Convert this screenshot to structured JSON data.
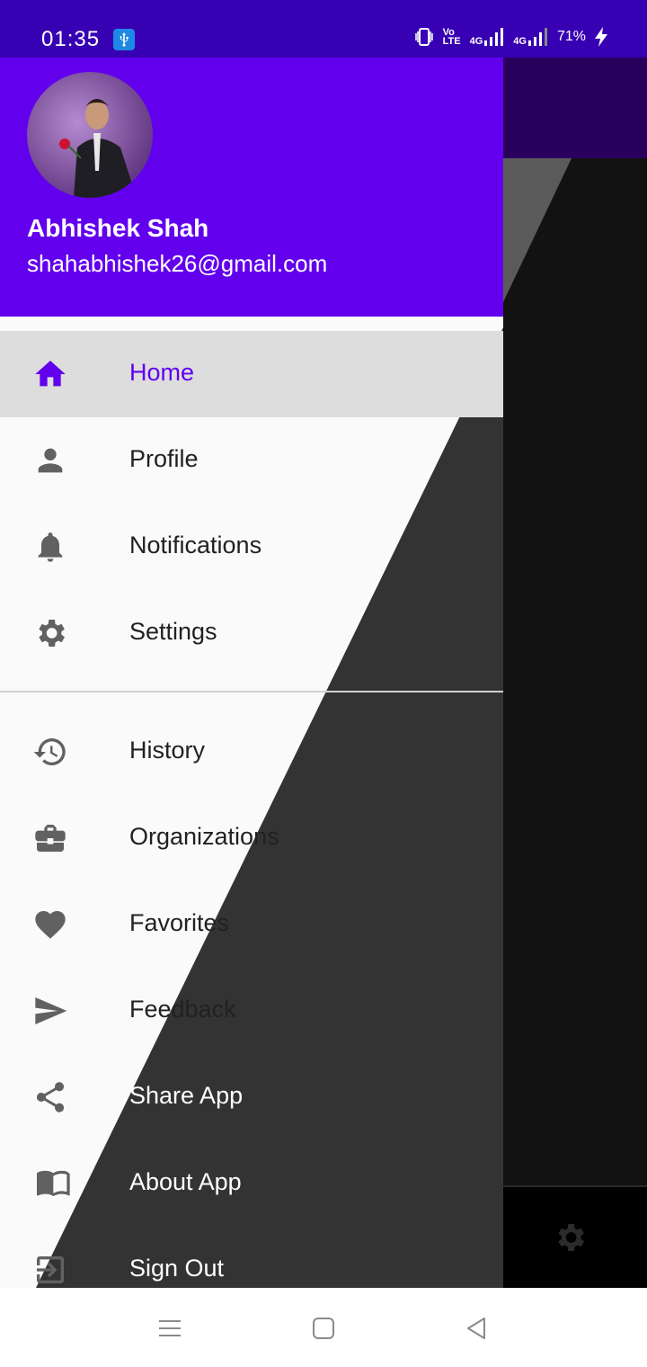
{
  "status_bar": {
    "time": "01:35",
    "volte": "Vo\nLTE",
    "net1": "4G",
    "net2": "4G",
    "battery": "71%",
    "icons": [
      "usb-icon",
      "vibrate-icon",
      "signal-icon",
      "signal-icon",
      "charging-icon"
    ]
  },
  "drawer": {
    "user_name": "Abhishek Shah",
    "user_email": "shahabhishek26@gmail.com",
    "primary_items": [
      {
        "label": "Home",
        "icon": "home-icon",
        "active": true
      },
      {
        "label": "Profile",
        "icon": "person-icon"
      },
      {
        "label": "Notifications",
        "icon": "bell-icon"
      },
      {
        "label": "Settings",
        "icon": "gear-icon"
      }
    ],
    "secondary_items": [
      {
        "label": "History",
        "icon": "history-icon"
      },
      {
        "label": "Organizations",
        "icon": "briefcase-icon"
      },
      {
        "label": "Favorites",
        "icon": "heart-icon"
      },
      {
        "label": "Feedback",
        "icon": "send-icon"
      },
      {
        "label": "Share App",
        "icon": "share-icon"
      },
      {
        "label": "About App",
        "icon": "book-icon"
      },
      {
        "label": "Sign Out",
        "icon": "logout-icon"
      }
    ]
  },
  "colors": {
    "primary": "#6200ee",
    "status_bar": "#3700b3",
    "icon_gray": "#616161"
  },
  "nav_bar": {
    "icons": [
      "menu-icon",
      "home-square-icon",
      "back-triangle-icon"
    ]
  }
}
